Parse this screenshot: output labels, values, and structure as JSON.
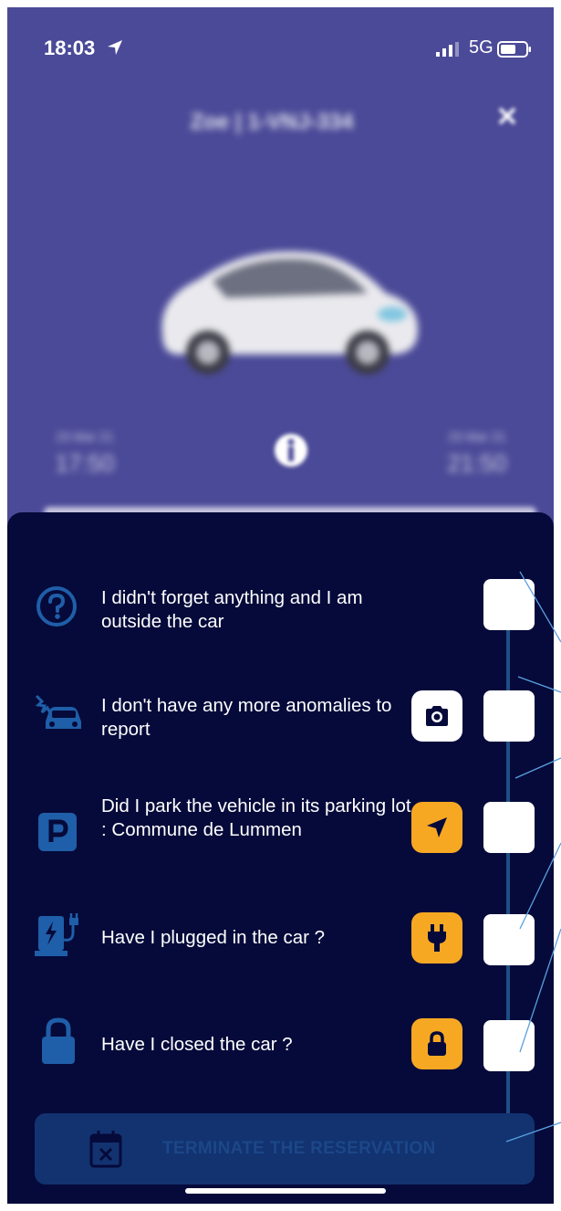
{
  "status_bar": {
    "time": "18:03",
    "network": "5G"
  },
  "header": {
    "title": "Zoe | 1-VNJ-334"
  },
  "reservation": {
    "start_date": "23 Mar 21",
    "start_time": "17:50",
    "end_date": "23 Mar 21",
    "end_time": "21:50"
  },
  "checklist": [
    {
      "text": "I didn't forget anything and I am outside the car",
      "icon": "question-icon"
    },
    {
      "text": "I don't have any more anomalies to report",
      "icon": "car-crash-icon",
      "action_icon": "camera-icon"
    },
    {
      "text": "Did I park the vehicle in its parking lot : Commune de Lummen",
      "icon": "parking-icon",
      "action_icon": "navigation-icon"
    },
    {
      "text": "Have I plugged in the car ?",
      "icon": "charging-station-icon",
      "action_icon": "plug-icon"
    },
    {
      "text": "Have I closed the car ?",
      "icon": "lock-icon",
      "action_icon": "lock-icon"
    }
  ],
  "terminate": {
    "label": "TERMINATE THE RESERVATION",
    "icon": "calendar-x-icon"
  },
  "colors": {
    "background": "#4b4a98",
    "sheet": "#050a3a",
    "accent_orange": "#f7a823",
    "button_disabled": "#123370"
  }
}
